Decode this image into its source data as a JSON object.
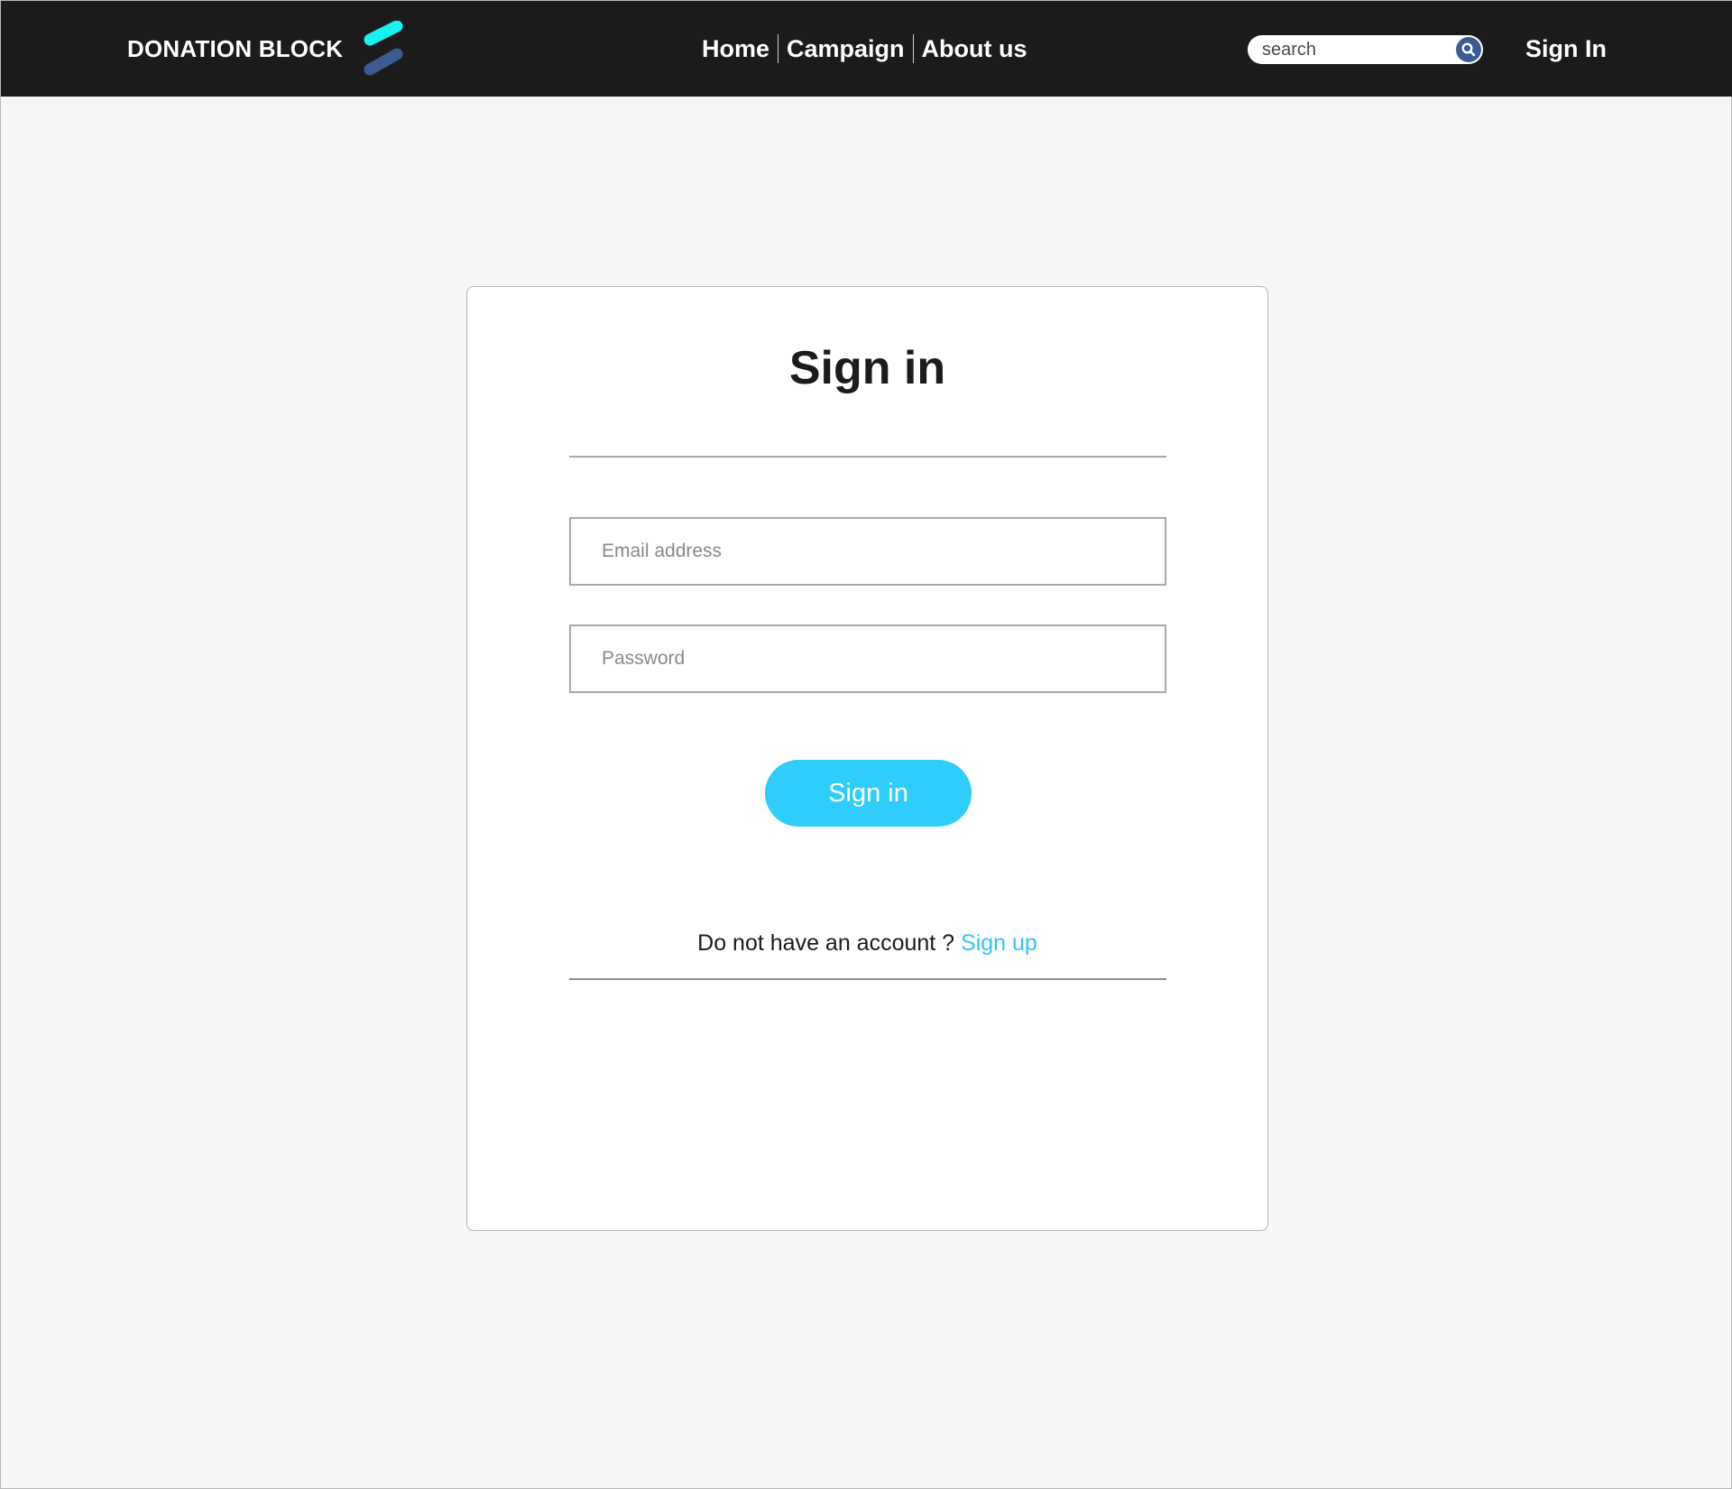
{
  "header": {
    "brand": "DONATION BLOCK",
    "nav": [
      "Home",
      "Campaign",
      "About us"
    ],
    "search": {
      "placeholder": "search"
    },
    "sign_in": "Sign In"
  },
  "card": {
    "title": "Sign in",
    "email_placeholder": "Email address",
    "password_placeholder": "Password",
    "submit": "Sign in",
    "no_account_text": "Do not have an account ?",
    "sign_up": "Sign up"
  },
  "colors": {
    "topbar": "#1b1b1b",
    "accent": "#2fcdfc",
    "logo_top": "#19f0f0",
    "logo_bottom": "#3b5b92",
    "search_button": "#3b5b92"
  },
  "icons": [
    "donation-block-logo-icon",
    "search-icon"
  ]
}
